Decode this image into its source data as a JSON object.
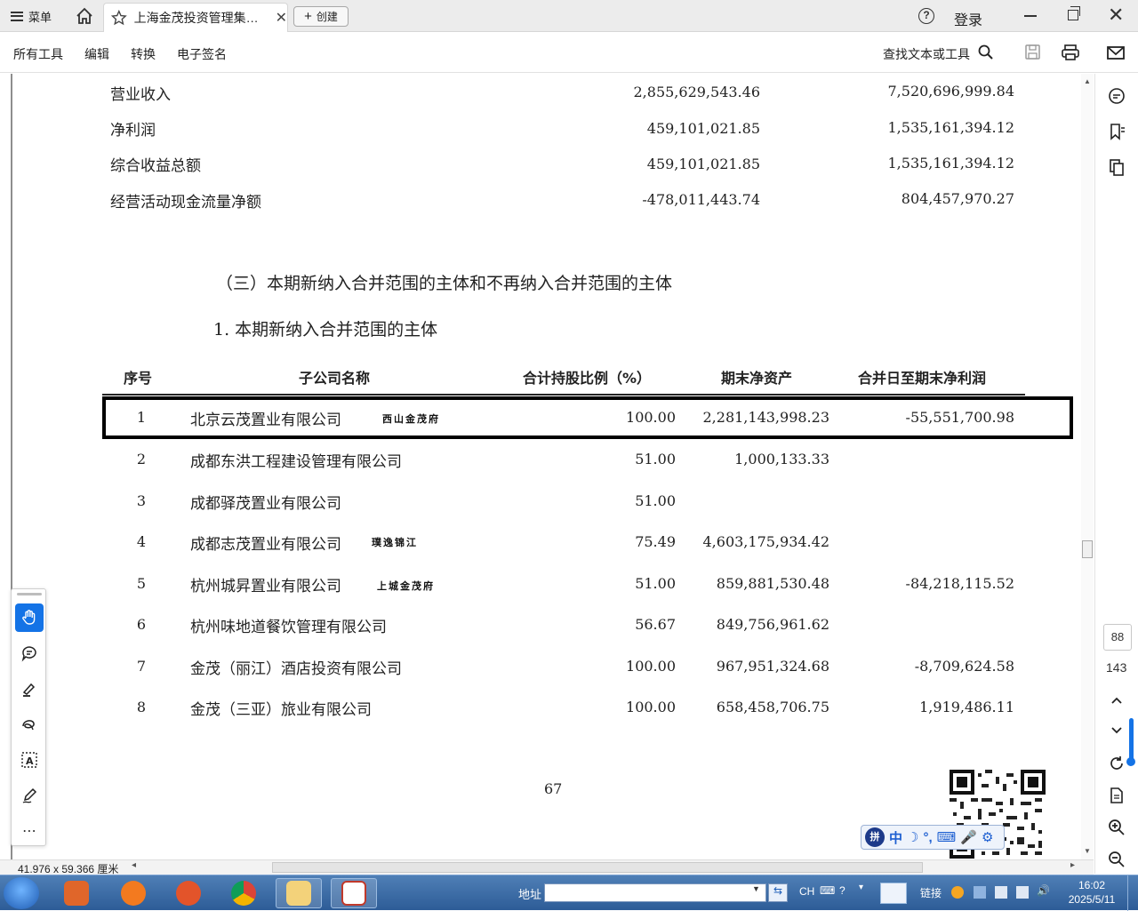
{
  "titlebar": {
    "menu_label": "菜单",
    "tab_title": "上海金茂投资管理集…",
    "create_label": "创建",
    "login_label": "登录"
  },
  "toolbar": {
    "items": [
      "所有工具",
      "编辑",
      "转换",
      "电子签名"
    ],
    "find_label": "查找文本或工具"
  },
  "summary_rows": [
    {
      "label": "营业收入",
      "current": "2,855,629,543.46",
      "previous": "7,520,696,999.84"
    },
    {
      "label": "净利润",
      "current": "459,101,021.85",
      "previous": "1,535,161,394.12"
    },
    {
      "label": "综合收益总额",
      "current": "459,101,021.85",
      "previous": "1,535,161,394.12"
    },
    {
      "label": "经营活动现金流量净额",
      "current": "-478,011,443.74",
      "previous": "804,457,970.27"
    }
  ],
  "section_heading": "（三）本期新纳入合并范围的主体和不再纳入合并范围的主体",
  "sub_heading": "1. 本期新纳入合并范围的主体",
  "table": {
    "headers": [
      "序号",
      "子公司名称",
      "合计持股比例（%）",
      "期末净资产",
      "合并日至期末净利润"
    ],
    "rows": [
      {
        "no": "1",
        "name": "北京云茂置业有限公司",
        "note": "西山金茂府",
        "ratio": "100.00",
        "net_assets": "2,281,143,998.23",
        "net_profit": "-55,551,700.98"
      },
      {
        "no": "2",
        "name": "成都东洪工程建设管理有限公司",
        "note": "",
        "ratio": "51.00",
        "net_assets": "1,000,133.33",
        "net_profit": ""
      },
      {
        "no": "3",
        "name": "成都驿茂置业有限公司",
        "note": "",
        "ratio": "51.00",
        "net_assets": "",
        "net_profit": ""
      },
      {
        "no": "4",
        "name": "成都志茂置业有限公司",
        "note": "璞逸锦江",
        "ratio": "75.49",
        "net_assets": "4,603,175,934.42",
        "net_profit": ""
      },
      {
        "no": "5",
        "name": "杭州城昇置业有限公司",
        "note": "上城金茂府",
        "ratio": "51.00",
        "net_assets": "859,881,530.48",
        "net_profit": "-84,218,115.52"
      },
      {
        "no": "6",
        "name": "杭州味地道餐饮管理有限公司",
        "note": "",
        "ratio": "56.67",
        "net_assets": "849,756,961.62",
        "net_profit": ""
      },
      {
        "no": "7",
        "name": "金茂（丽江）酒店投资有限公司",
        "note": "",
        "ratio": "100.00",
        "net_assets": "967,951,324.68",
        "net_profit": "-8,709,624.58"
      },
      {
        "no": "8",
        "name": "金茂（三亚）旅业有限公司",
        "note": "",
        "ratio": "100.00",
        "net_assets": "658,458,706.75",
        "net_profit": "1,919,486.11"
      }
    ]
  },
  "page_number": "67",
  "navigation": {
    "current_page": "88",
    "total_pages": "143"
  },
  "status": {
    "dimensions": "41.976 x 59.366 厘米"
  },
  "ime": {
    "chars": [
      "中",
      "☽",
      "°,",
      "⌨",
      "🎤",
      "⚙"
    ],
    "logo": "拼"
  },
  "taskbar": {
    "address_label": "地址",
    "tray_ch": "CH",
    "links_label": "链接",
    "time": "16:02",
    "date": "2025/5/11"
  },
  "colors": {
    "accent": "#1473e6",
    "highlight_border": "#000000",
    "taskbar": "#2d5c97"
  }
}
